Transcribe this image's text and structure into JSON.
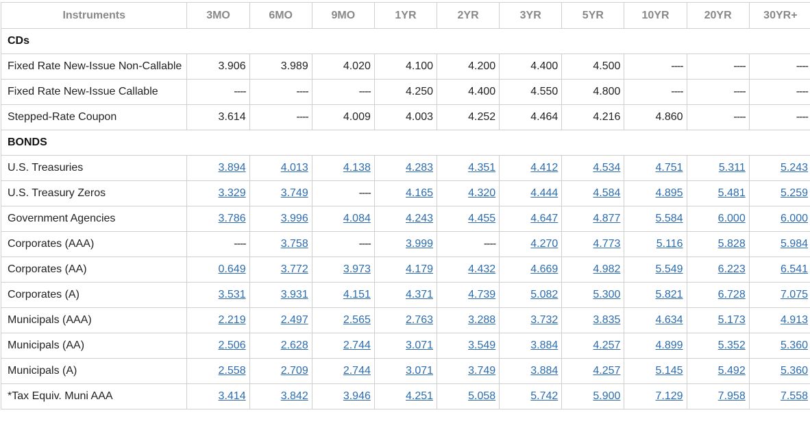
{
  "header": {
    "instruments": "Instruments",
    "terms": [
      "3MO",
      "6MO",
      "9MO",
      "1YR",
      "2YR",
      "3YR",
      "5YR",
      "10YR",
      "20YR",
      "30YR+"
    ]
  },
  "dash": "----",
  "sections": [
    {
      "title": "CDs",
      "linked": false,
      "rows": [
        {
          "name": "Fixed Rate New-Issue Non-Callable",
          "values": [
            "3.906",
            "3.989",
            "4.020",
            "4.100",
            "4.200",
            "4.400",
            "4.500",
            null,
            null,
            null
          ]
        },
        {
          "name": "Fixed Rate New-Issue Callable",
          "values": [
            null,
            null,
            null,
            "4.250",
            "4.400",
            "4.550",
            "4.800",
            null,
            null,
            null
          ]
        },
        {
          "name": "Stepped-Rate Coupon",
          "values": [
            "3.614",
            null,
            "4.009",
            "4.003",
            "4.252",
            "4.464",
            "4.216",
            "4.860",
            null,
            null
          ]
        }
      ]
    },
    {
      "title": "BONDS",
      "linked": true,
      "rows": [
        {
          "name": "U.S. Treasuries",
          "values": [
            "3.894",
            "4.013",
            "4.138",
            "4.283",
            "4.351",
            "4.412",
            "4.534",
            "4.751",
            "5.311",
            "5.243"
          ]
        },
        {
          "name": "U.S. Treasury Zeros",
          "values": [
            "3.329",
            "3.749",
            null,
            "4.165",
            "4.320",
            "4.444",
            "4.584",
            "4.895",
            "5.481",
            "5.259"
          ]
        },
        {
          "name": "Government Agencies",
          "values": [
            "3.786",
            "3.996",
            "4.084",
            "4.243",
            "4.455",
            "4.647",
            "4.877",
            "5.584",
            "6.000",
            "6.000"
          ]
        },
        {
          "name": "Corporates (AAA)",
          "values": [
            null,
            "3.758",
            null,
            "3.999",
            null,
            "4.270",
            "4.773",
            "5.116",
            "5.828",
            "5.984"
          ]
        },
        {
          "name": "Corporates (AA)",
          "values": [
            "0.649",
            "3.772",
            "3.973",
            "4.179",
            "4.432",
            "4.669",
            "4.982",
            "5.549",
            "6.223",
            "6.541"
          ]
        },
        {
          "name": "Corporates (A)",
          "values": [
            "3.531",
            "3.931",
            "4.151",
            "4.371",
            "4.739",
            "5.082",
            "5.300",
            "5.821",
            "6.728",
            "7.075"
          ]
        },
        {
          "name": "Municipals (AAA)",
          "values": [
            "2.219",
            "2.497",
            "2.565",
            "2.763",
            "3.288",
            "3.732",
            "3.835",
            "4.634",
            "5.173",
            "4.913"
          ]
        },
        {
          "name": "Municipals (AA)",
          "values": [
            "2.506",
            "2.628",
            "2.744",
            "3.071",
            "3.549",
            "3.884",
            "4.257",
            "4.899",
            "5.352",
            "5.360"
          ]
        },
        {
          "name": "Municipals (A)",
          "values": [
            "2.558",
            "2.709",
            "2.744",
            "3.071",
            "3.749",
            "3.884",
            "4.257",
            "5.145",
            "5.492",
            "5.360"
          ]
        },
        {
          "name": "*Tax Equiv. Muni AAA",
          "values": [
            "3.414",
            "3.842",
            "3.946",
            "4.251",
            "5.058",
            "5.742",
            "5.900",
            "7.129",
            "7.958",
            "7.558"
          ]
        }
      ]
    }
  ]
}
